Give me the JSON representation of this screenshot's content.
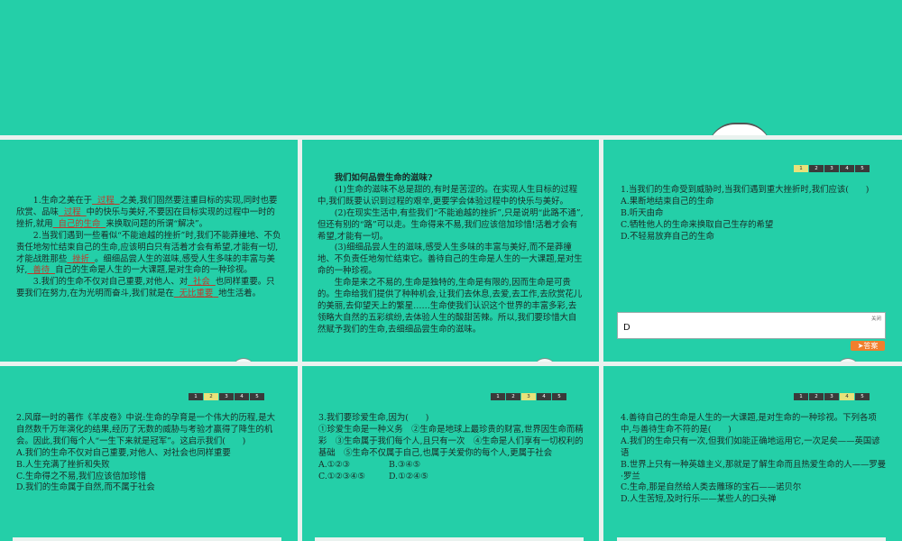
{
  "card1": {
    "p1_a": "1.生命之美在于",
    "p1_b1": "过程",
    "p1_c": "之美,我们固然要注重目标的实现,同时也要欣赏、品味",
    "p1_b2": "过程",
    "p1_d": "中的快乐与美好,不要因在目标实现的过程中一时的挫折,就用",
    "p1_b3": "自己的生命",
    "p1_e": "来换取问题的所谓“解决”。",
    "p2_a": "2.当我们遇到一些看似“不能逾越的挫折”时,我们不能莽撞地、不负责任地匆忙结束自己的生命,应该明白只有活着才会有希望,才能有一切,才能战胜那些",
    "p2_b1": "挫折",
    "p2_c": "。细细品尝人生的滋味,感受人生多味的丰富与美好,",
    "p2_b2": "善待",
    "p2_d": "自己的生命是人生的一大课题,是对生命的一种珍视。",
    "p3_a": "3.我们的生命不仅对自己重要,对他人、对",
    "p3_b1": "社会",
    "p3_c": "也同样重要。只要我们在努力,在为光明而奋斗,我们就是在",
    "p3_b2": "无比重要",
    "p3_d": "地生活着。"
  },
  "card2": {
    "title": "我们如何品尝生命的滋味?",
    "p1": "(1)生命的滋味不总是甜的,有时是苦涩的。在实现人生目标的过程中,我们既要认识到过程的艰辛,更要学会体验过程中的快乐与美好。",
    "p2": "(2)在现实生活中,有些我们“不能逾越的挫折”,只是说明“此路不通”,但还有别的“路”可以走。生命得来不易,我们应该倍加珍惜!活着才会有希望,才能有一切。",
    "p3": "(3)细细品尝人生的滋味,感受人生多味的丰富与美好,而不是莽撞地、不负责任地匆忙结束它。善待自己的生命是人生的一大课题,是对生命的一种珍视。",
    "p4": "生命是来之不易的,生命是独特的,生命是有限的,因而生命是可贵的。生命给我们提供了种种机会,让我们去休息,去爱,去工作,去欣赏花儿的美丽,去仰望天上的繁星……生命使我们认识这个世界的丰富多彩,去领略大自然的五彩缤纷,去体验人生的酸甜苦辣。所以,我们要珍惜大自然赋予我们的生命,去细细品尝生命的滋味。"
  },
  "pager": [
    "1",
    "2",
    "3",
    "4",
    "5"
  ],
  "card3": {
    "q": "1.当我们的生命受到威胁时,当我们遇到重大挫折时,我们应该(　　)",
    "a": "A.果断地结束自己的生命",
    "b": "B.听天由命",
    "c": "C.牺牲他人的生命来换取自己生存的希望",
    "d": "D.不轻易放弃自己的生命",
    "close": "关闭",
    "answer": "D",
    "answer_btn": "答案"
  },
  "card4": {
    "q": "2.风靡一时的著作《羊皮卷》中说:生命的孕育是一个伟大的历程,是大自然数千万年演化的结果,经历了无数的威胁与考验才赢得了降生的机会。因此,我们每个人“一生下来就是冠军”。这启示我们(　　)",
    "a": "A.我们的生命不仅对自己重要,对他人、对社会也同样重要",
    "b": "B.人生充满了挫折和失败",
    "c": "C.生命得之不易,我们应该倍加珍惜",
    "d": "D.我们的生命属于自然,而不属于社会"
  },
  "card5": {
    "q": "3.我们要珍爱生命,因为(　　)",
    "opts": "①珍爱生命是一种义务　②生命是地球上最珍贵的财富,世界因生命而精彩　③生命属于我们每个人,且只有一次　④生命是人们享有一切权利的基础　⑤生命不仅属于自己,也属于关爱你的每个人,更属于社会",
    "row1a": "A.①②③",
    "row1b": "B.③④⑤",
    "row2a": "C.①②③④⑤",
    "row2b": "D.①②④⑤"
  },
  "card6": {
    "q": "4.善待自己的生命是人生的一大课题,是对生命的一种珍视。下列各项中,与善待生命不符的是(　　)",
    "a": "A.我们的生命只有一次,但我们如能正确地运用它,一次足矣——英国谚语",
    "b": "B.世界上只有一种英雄主义,那就是了解生命而且热爱生命的人——罗曼·罗兰",
    "c": "C.生命,那是自然给人类去雕琢的宝石——诺贝尔",
    "d": "D.人生苦短,及时行乐——某些人的口头禅"
  },
  "colors": {
    "background": "#24cfa8",
    "highlight": "#c0392b",
    "answer_button": "#f07f2c",
    "current_page": "#e9e27a"
  }
}
